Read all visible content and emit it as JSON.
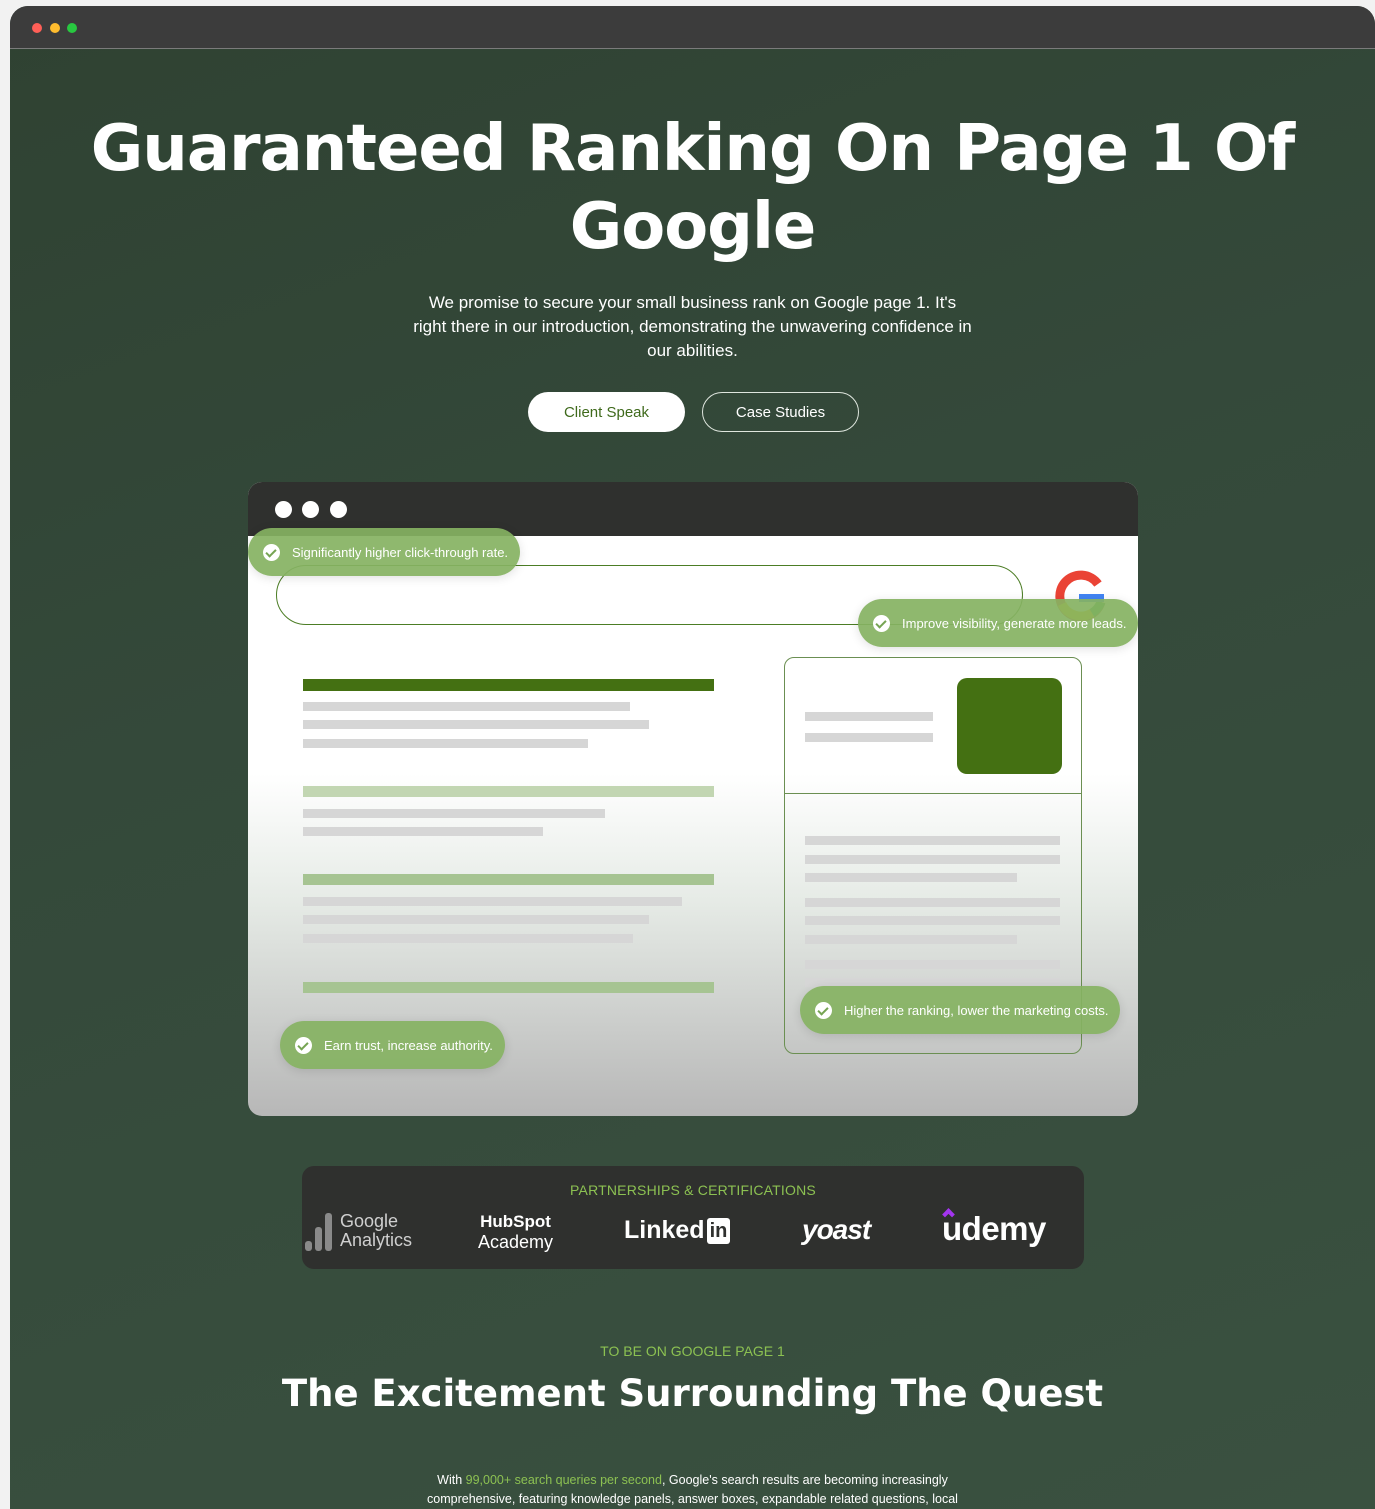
{
  "hero": {
    "title": "Guaranteed Ranking On Page 1 Of Google",
    "subtitle": "We promise to secure your small business rank on Google page 1. It's right there in our introduction, demonstrating the unwavering confidence in our abilities.",
    "primary_button": "Client Speak",
    "secondary_button": "Case Studies"
  },
  "mockup": {
    "benefits": [
      "Significantly higher click-through rate.",
      "Improve visibility, generate more leads.",
      "Higher the ranking, lower the marketing costs.",
      "Earn trust, increase authority."
    ],
    "search_logo": "google-g-icon"
  },
  "partners": {
    "label": "PARTNERSHIPS & CERTIFICATIONS",
    "logos": [
      {
        "name": "Google Analytics",
        "line1": "Google",
        "line2": "Analytics"
      },
      {
        "name": "HubSpot Academy",
        "line1": "HubSpot",
        "line2": "Academy"
      },
      {
        "name": "LinkedIn",
        "line1": "Linked",
        "line2": "in"
      },
      {
        "name": "yoast",
        "line1": "yoast"
      },
      {
        "name": "udemy",
        "line1": "udemy"
      }
    ]
  },
  "section": {
    "eyebrow": "TO BE ON GOOGLE PAGE 1",
    "title": "The Excitement Surrounding The Quest",
    "body_prefix": "With ",
    "body_highlight": "99,000+ search queries per second",
    "body_suffix": ", Google's search results are becoming increasingly comprehensive, featuring knowledge panels, answer boxes, expandable related questions, local"
  },
  "colors": {
    "accent_green": "#8cc152",
    "brand_dark_green": "#447012",
    "background": "#34493a"
  }
}
